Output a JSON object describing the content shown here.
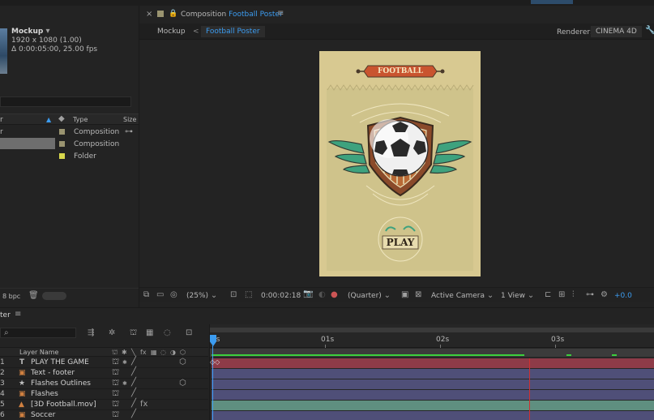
{
  "project": {
    "item_name": "Mockup",
    "item_dims": "1920 x 1080 (1.00)",
    "item_duration": "Δ 0:00:05:00, 25.00 fps",
    "columns": {
      "name": "r",
      "type": "Type",
      "size": "Size"
    },
    "rows": [
      {
        "name": "r",
        "type": "Composition",
        "color": "#9a9470"
      },
      {
        "name": "",
        "type": "Composition",
        "color": "#9a9470"
      },
      {
        "name": "",
        "type": "Folder",
        "color": "#d7d74c"
      }
    ],
    "bpc": "8 bpc"
  },
  "comp_header": {
    "close": "×",
    "title_prefix": "Composition",
    "title_name": "Football Poster",
    "menu": "≡",
    "breadcrumb_1": "Mockup",
    "breadcrumb_sep": "<",
    "breadcrumb_2": "Football Poster",
    "renderer_label": "Renderer:",
    "renderer_value": "CINEMA 4D"
  },
  "poster": {
    "ribbon_text": "FOOTBALL",
    "badge_text": "PLAY",
    "bg_color": "#d8c991",
    "ribbon_color": "#c9542f",
    "wing_color": "#3ea27e"
  },
  "viewer_bar": {
    "zoom": "(25%)",
    "timecode": "0:00:02:18",
    "resolution": "(Quarter)",
    "camera": "Active Camera",
    "views": "1 View",
    "exposure": "+0.0"
  },
  "timeline": {
    "panel_title": "ter",
    "panel_menu": "≡",
    "search_icon": "⌕",
    "layer_name_header": "Layer Name",
    "ruler": [
      "0s",
      "01s",
      "02s",
      "03s"
    ],
    "layers": [
      {
        "num": "1",
        "type": "T",
        "name": "PLAY THE GAME",
        "bar_color": "#8e3b48"
      },
      {
        "num": "2",
        "type": "▣",
        "name": "Text - footer",
        "bar_color": "#4f4f78"
      },
      {
        "num": "3",
        "type": "★",
        "name": "Flashes Outlines",
        "bar_color": "#4f4f78"
      },
      {
        "num": "4",
        "type": "▣",
        "name": "Flashes",
        "bar_color": "#4f4f78"
      },
      {
        "num": "5",
        "type": "▲",
        "name": "[3D Football.mov]",
        "bar_color": "#5f8f80"
      },
      {
        "num": "6",
        "type": "▣",
        "name": "Soccer",
        "bar_color": "#4f4f78"
      }
    ]
  }
}
